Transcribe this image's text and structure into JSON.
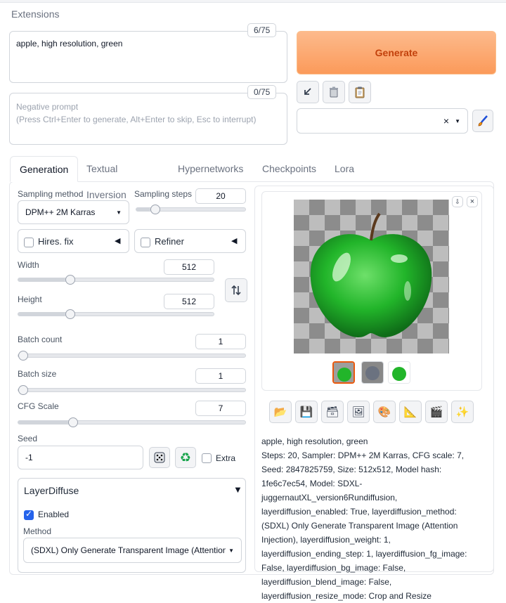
{
  "top_tab": "Extensions",
  "prompt": {
    "value": "apple, high resolution, green",
    "counter": "6/75"
  },
  "negative_prompt": {
    "placeholder": "Negative prompt\n(Press Ctrl+Enter to generate, Alt+Enter to skip, Esc to interrupt)",
    "counter": "0/75"
  },
  "generate_label": "Generate",
  "tool_icons": [
    "arrow-down-left-icon",
    "trash-icon",
    "clipboard-icon"
  ],
  "styles_clear": "×",
  "main_tabs": [
    "Generation",
    "Textual Inversion",
    "Hypernetworks",
    "Checkpoints",
    "Lora"
  ],
  "sampling": {
    "method_label": "Sampling method",
    "method_value": "DPM++ 2M Karras",
    "steps_label": "Sampling steps",
    "steps_value": "20",
    "steps_fraction": 0.13
  },
  "hires": {
    "label": "Hires. fix"
  },
  "refiner": {
    "label": "Refiner"
  },
  "width": {
    "label": "Width",
    "value": "512",
    "fraction": 0.24
  },
  "height": {
    "label": "Height",
    "value": "512",
    "fraction": 0.24
  },
  "batch_count": {
    "label": "Batch count",
    "value": "1",
    "fraction": 0.0
  },
  "batch_size": {
    "label": "Batch size",
    "value": "1",
    "fraction": 0.0
  },
  "cfg": {
    "label": "CFG Scale",
    "value": "7",
    "fraction": 0.22
  },
  "seed": {
    "label": "Seed",
    "value": "-1",
    "extra_label": "Extra"
  },
  "layerdiffuse": {
    "title": "LayerDiffuse",
    "enabled_label": "Enabled",
    "method_label": "Method",
    "method_value": "(SDXL) Only Generate Transparent Image (Attention"
  },
  "info": {
    "prompt_line": "apple, high resolution, green",
    "params": "Steps: 20, Sampler: DPM++ 2M Karras, CFG scale: 7, Seed: 2847825759, Size: 512x512, Model hash: 1fe6c7ec54, Model: SDXL-juggernautXL_version6Rundiffusion, layerdiffusion_enabled: True, layerdiffusion_method: (SDXL) Only Generate Transparent Image (Attention Injection), layerdiffusion_weight: 1, layerdiffusion_ending_step: 1, layerdiffusion_fg_image: False, layerdiffusion_bg_image: False, layerdiffusion_blend_image: False, layerdiffusion_resize_mode: Crop and Resize"
  },
  "colors": {
    "generate_bg": "#fb9a5a",
    "accent": "#ea580c",
    "checkbox_checked": "#2563eb"
  }
}
